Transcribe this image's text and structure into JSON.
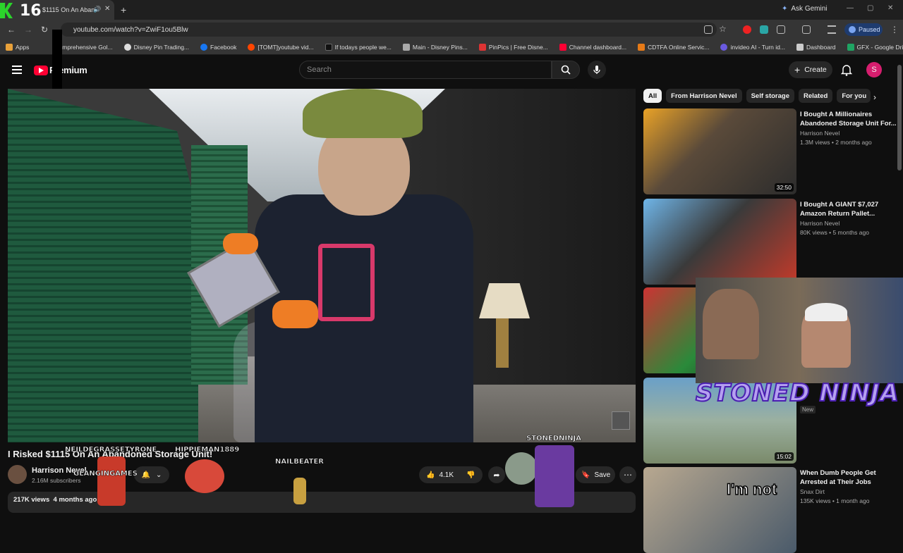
{
  "browser": {
    "tab_number": "16",
    "tab_title": "$1115 On An Aban",
    "gemini_label": "Ask Gemini",
    "url": "youtube.com/watch?v=ZwiF1ou5Blw",
    "profile_status": "Paused",
    "bookmarks": [
      "Apps",
      "Comprehensive Gol...",
      "Disney Pin Trading...",
      "Facebook",
      "[TOMT]youtube vid...",
      "If todays people we...",
      "Main - Disney Pins...",
      "PinPics | Free Disne...",
      "Channel dashboard...",
      "CDTFA Online Servic...",
      "invideo AI - Turn id...",
      "Dashboard",
      "GFX - Google Drive"
    ]
  },
  "youtube": {
    "logo_text": "Premium",
    "search_placeholder": "Search",
    "create_label": "Create",
    "avatar_letter": "S"
  },
  "video": {
    "title": "I Risked $1115 On An Abandoned Storage Unit!",
    "channel": "Harrison Nevel",
    "subscribers": "2.16M subscribers",
    "likes": "4.1K",
    "save_label": "Save",
    "views": "217K views",
    "age": "4 months ago"
  },
  "chips": [
    "All",
    "From Harrison Nevel",
    "Self storage",
    "Related",
    "For you"
  ],
  "recommendations": [
    {
      "title": "I Bought A Millionaires Abandoned Storage Unit For...",
      "channel": "Harrison Nevel",
      "meta": "1.3M views • 2 months ago",
      "duration": "32:50"
    },
    {
      "title": "I Bought A GIANT $7,027 Amazon Return Pallet...",
      "channel": "Harrison Nevel",
      "meta": "80K views • 5 months ago",
      "duration": ""
    },
    {
      "title": "",
      "channel": "",
      "meta": "",
      "duration": "",
      "badge": "New"
    },
    {
      "title": "",
      "channel": "",
      "meta": "",
      "duration": "15:02"
    },
    {
      "title": "When Dumb People Get Arrested at Their Jobs",
      "channel": "Snax Dirt",
      "meta": "135K views • 1 month ago",
      "duration": ""
    }
  ],
  "overlay": {
    "streamer_name": "STONED NINJA",
    "caption": "I'm not",
    "chat_names": [
      "NEILDEGRASSETYRONE",
      "HIPPIEMAN1889",
      "GLANGINGAMES",
      "NAILBEATER",
      "STONEDNINJA"
    ]
  },
  "colors": {
    "accent": "#ff0033",
    "bg": "#0f0f0f",
    "chip_bg": "#272727",
    "overlay_purple": "#b5a0f0"
  }
}
